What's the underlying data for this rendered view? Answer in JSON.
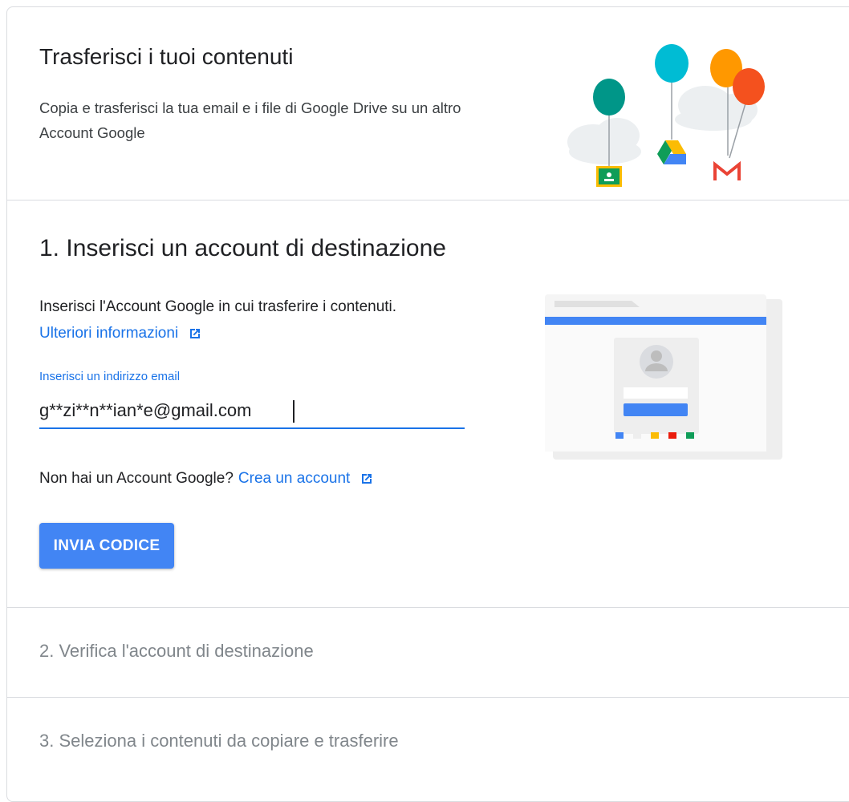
{
  "header": {
    "title": "Trasferisci i tuoi contenuti",
    "description": "Copia e trasferisci la tua email e i file di Google Drive su un altro Account Google"
  },
  "step1": {
    "title": "1. Inserisci un account di destinazione",
    "description": "Inserisci l'Account Google in cui trasferire i contenuti.",
    "learn_more": "Ulteriori informazioni",
    "field_label": "Inserisci un indirizzo email",
    "email_value": "g**zi**n**ian*e@gmail.com",
    "no_account_text": "Non hai un Account Google?",
    "create_account": "Crea un account",
    "send_button": "INVIA CODICE"
  },
  "step2": {
    "title": "2. Verifica l'account di destinazione"
  },
  "step3": {
    "title": "3. Seleziona i contenuti da copiare e trasferire"
  },
  "colors": {
    "accent": "#1a73e8",
    "button": "#4285f4",
    "muted_text": "#80868b",
    "divider": "#dadce0"
  },
  "icons": {
    "external_link": "open-in-new-icon",
    "classroom": "google-classroom-icon",
    "drive": "google-drive-icon",
    "gmail": "gmail-icon",
    "avatar": "avatar-icon"
  }
}
